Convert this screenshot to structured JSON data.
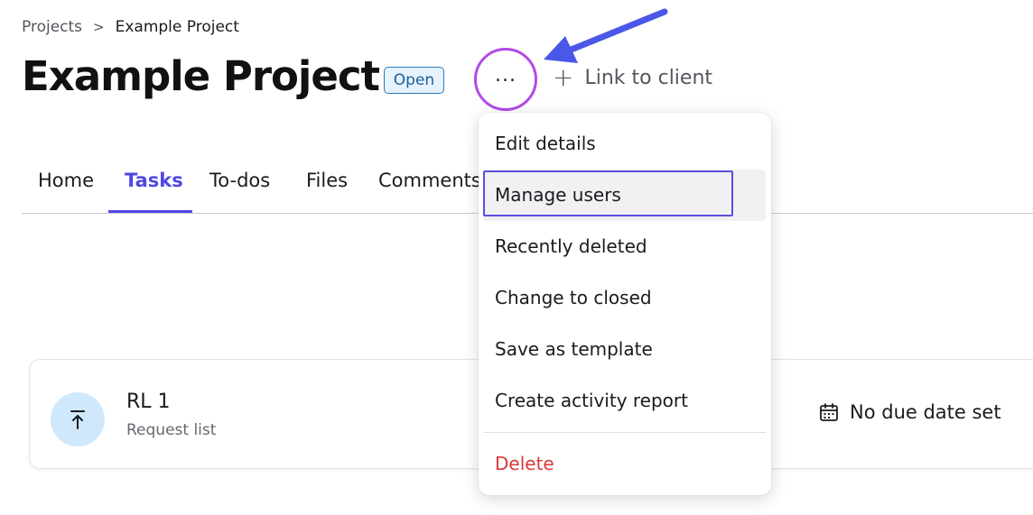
{
  "breadcrumb": {
    "parent": "Projects",
    "separator": ">",
    "current": "Example Project"
  },
  "project": {
    "title": "Example Project",
    "status": "Open",
    "link_client_label": "Link to client"
  },
  "icons": {
    "more": "more-horizontal-icon",
    "plus": "plus-icon",
    "upload": "upload-icon",
    "calendar": "calendar-icon"
  },
  "tabs": [
    {
      "label": "Home",
      "active": false
    },
    {
      "label": "Tasks",
      "active": true
    },
    {
      "label": "To-dos",
      "active": false
    },
    {
      "label": "Files",
      "active": false
    },
    {
      "label": "Comments",
      "active": false
    }
  ],
  "task": {
    "title": "RL 1",
    "subtitle": "Request list",
    "due": "No due date set"
  },
  "menu": {
    "items": [
      {
        "label": "Edit details"
      },
      {
        "label": "Manage users",
        "highlighted": true
      },
      {
        "label": "Recently deleted"
      },
      {
        "label": "Change to closed"
      },
      {
        "label": "Save as template"
      },
      {
        "label": "Create activity report"
      }
    ],
    "delete_label": "Delete"
  },
  "colors": {
    "accent": "#5046e5",
    "highlight_ring": "#b24be6",
    "annotation_arrow": "#4a57e8",
    "danger": "#d93a3a",
    "badge_border": "#2a7bb8"
  }
}
